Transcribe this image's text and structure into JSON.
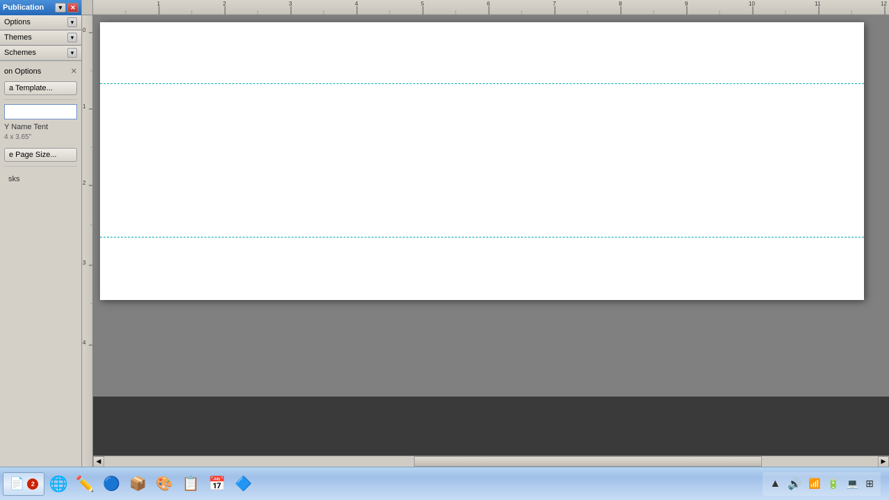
{
  "window": {
    "title": "Publication",
    "controls": {
      "minimize": "▼",
      "close": "✕"
    }
  },
  "leftPanel": {
    "sections": [
      {
        "id": "options",
        "label": "Options",
        "collapsed": false
      },
      {
        "id": "themes",
        "label": "Themes",
        "collapsed": false
      },
      {
        "id": "color-schemes",
        "label": "Schemes",
        "collapsed": false
      }
    ],
    "creationOptions": {
      "title": "on Options",
      "templateButton": "a Template...",
      "inputPlaceholder": "",
      "templateName": "Y Name Tent",
      "templateSize": "4 x 3.65\"",
      "pageSizeButton": "e Page Size...",
      "tasksLabel": "sks"
    }
  },
  "canvas": {
    "rulerMarks": [
      "1",
      "2",
      "3",
      "4",
      "5",
      "6",
      "7",
      "8",
      "9",
      "10",
      "11",
      "12"
    ],
    "verticalMarks": [
      "0",
      "1",
      "2",
      "3",
      "4"
    ]
  },
  "taskbar": {
    "activeApp": {
      "icon": "📄",
      "badge": "2"
    },
    "icons": [
      {
        "id": "globe",
        "symbol": "🌐"
      },
      {
        "id": "pen",
        "symbol": "✏️"
      },
      {
        "id": "chrome",
        "symbol": "🔵"
      },
      {
        "id": "7zip",
        "symbol": "📦"
      },
      {
        "id": "photoshop",
        "symbol": "🎨"
      },
      {
        "id": "publisher",
        "symbol": "📋"
      },
      {
        "id": "calendar",
        "symbol": "📅"
      },
      {
        "id": "app6",
        "symbol": "🔷"
      }
    ],
    "tray": {
      "time": "",
      "icons": [
        "🔊",
        "📶",
        "🔋",
        "💻"
      ]
    }
  }
}
